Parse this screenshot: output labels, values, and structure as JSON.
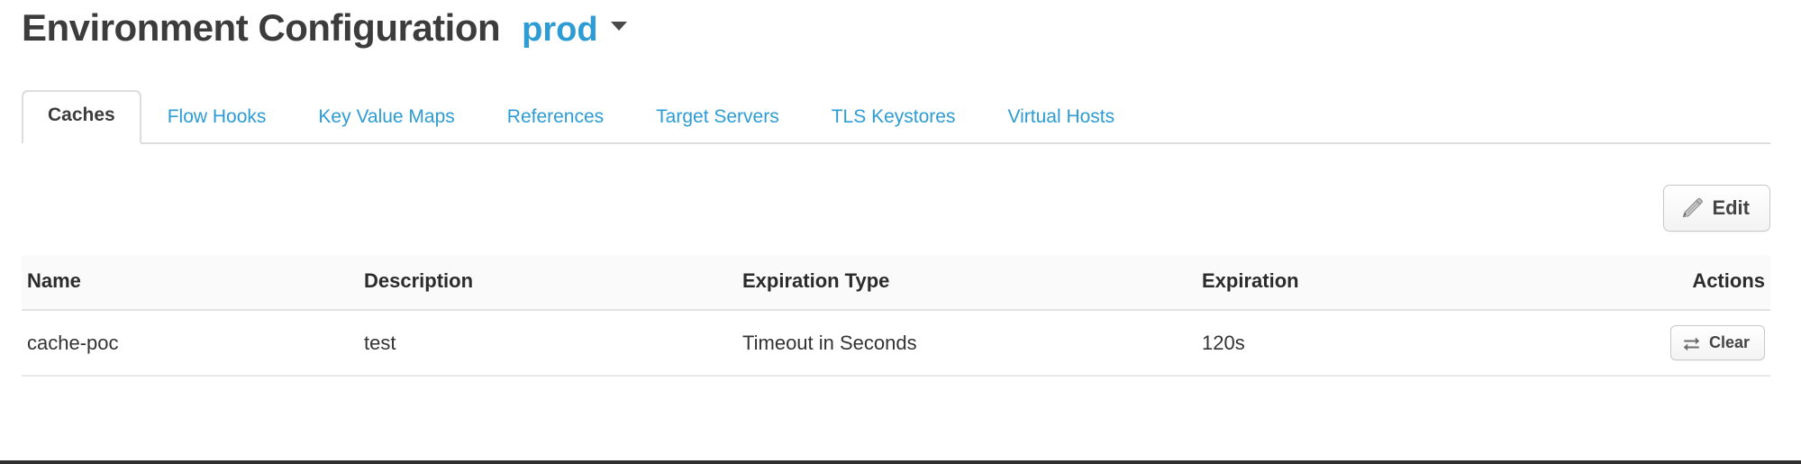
{
  "header": {
    "title": "Environment Configuration",
    "environment": {
      "name": "prod",
      "caret_icon": "chevron-down-icon"
    }
  },
  "tabs": [
    {
      "label": "Caches",
      "active": true
    },
    {
      "label": "Flow Hooks",
      "active": false
    },
    {
      "label": "Key Value Maps",
      "active": false
    },
    {
      "label": "References",
      "active": false
    },
    {
      "label": "Target Servers",
      "active": false
    },
    {
      "label": "TLS Keystores",
      "active": false
    },
    {
      "label": "Virtual Hosts",
      "active": false
    }
  ],
  "toolbar": {
    "edit_label": "Edit",
    "edit_icon": "pencil-icon"
  },
  "table": {
    "columns": [
      "Name",
      "Description",
      "Expiration Type",
      "Expiration",
      "Actions"
    ],
    "rows": [
      {
        "name": "cache-poc",
        "description": "test",
        "expiration_type": "Timeout in Seconds",
        "expiration": "120s",
        "action_label": "Clear",
        "action_icon": "exchange-icon"
      }
    ]
  },
  "colors": {
    "link": "#2d9cd5",
    "text": "#333333",
    "heading": "#3c3c3c",
    "border": "#dddddd",
    "header_row_bg": "#fafafa"
  }
}
